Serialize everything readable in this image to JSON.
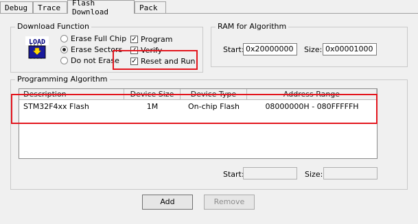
{
  "tabs": [
    {
      "label": "Debug"
    },
    {
      "label": "Trace"
    },
    {
      "label": "Flash Download"
    },
    {
      "label": "Pack"
    }
  ],
  "download_function": {
    "title": "Download Function",
    "icon": "load-chip-icon",
    "radios": [
      {
        "label": "Erase Full Chip",
        "selected": false
      },
      {
        "label": "Erase Sectors",
        "selected": true
      },
      {
        "label": "Do not Erase",
        "selected": false
      }
    ],
    "checks": [
      {
        "label": "Program",
        "checked": true
      },
      {
        "label": "Verify",
        "checked": true
      },
      {
        "label": "Reset and Run",
        "checked": true
      }
    ]
  },
  "ram": {
    "title": "RAM for Algorithm",
    "start_label": "Start:",
    "start_value": "0x20000000",
    "size_label": "Size:",
    "size_value": "0x00001000"
  },
  "programming": {
    "title": "Programming Algorithm",
    "columns": [
      "Description",
      "Device Size",
      "Device Type",
      "Address Range"
    ],
    "rows": [
      {
        "description": "STM32F4xx Flash",
        "size": "1M",
        "type": "On-chip Flash",
        "range": "08000000H - 080FFFFFH"
      }
    ],
    "start_label": "Start:",
    "start_value": "",
    "size_label": "Size:",
    "size_value": ""
  },
  "buttons": {
    "add": "Add",
    "remove": "Remove"
  },
  "highlight_color": "#e3141c"
}
